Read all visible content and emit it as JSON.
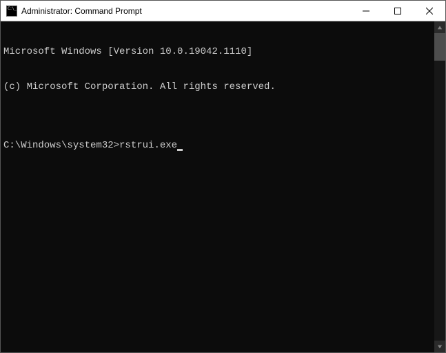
{
  "window": {
    "title": "Administrator: Command Prompt"
  },
  "terminal": {
    "line1": "Microsoft Windows [Version 10.0.19042.1110]",
    "line2": "(c) Microsoft Corporation. All rights reserved.",
    "blank": "",
    "prompt_path": "C:\\Windows\\system32>",
    "command": "rstrui.exe"
  }
}
